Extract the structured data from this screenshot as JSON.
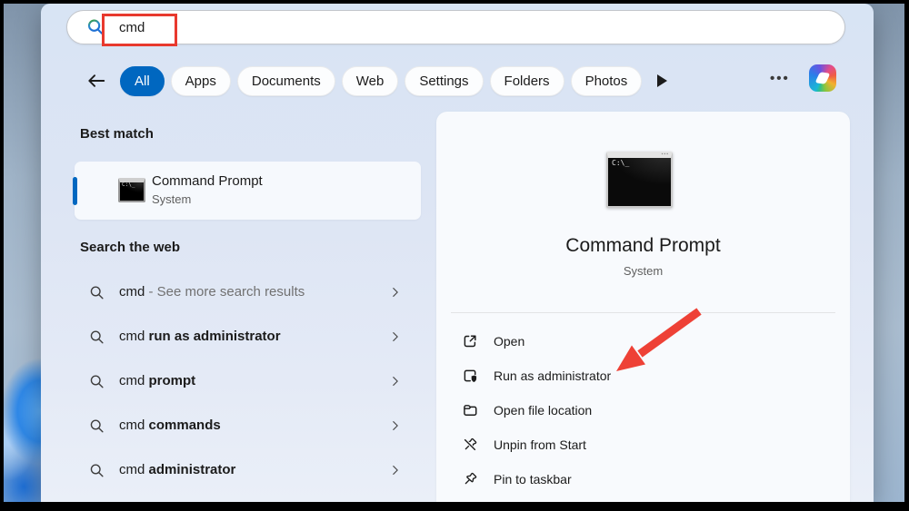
{
  "search": {
    "query": "cmd"
  },
  "tabs": {
    "items": [
      "All",
      "Apps",
      "Documents",
      "Web",
      "Settings",
      "Folders",
      "Photos"
    ],
    "active": "All",
    "more_glyph": "•••"
  },
  "results": {
    "best_match_heading": "Best match",
    "best_match": {
      "title": "Command Prompt",
      "subtitle": "System"
    },
    "web_heading": "Search the web",
    "suggestions": [
      {
        "query": "cmd",
        "suffix": " - See more search results"
      },
      {
        "query": "cmd ",
        "suffix": "run as administrator"
      },
      {
        "query": "cmd ",
        "suffix": "prompt"
      },
      {
        "query": "cmd ",
        "suffix": "commands"
      },
      {
        "query": "cmd ",
        "suffix": "administrator"
      }
    ]
  },
  "details": {
    "title": "Command Prompt",
    "subtitle": "System",
    "actions": [
      {
        "icon": "open-icon",
        "label": "Open"
      },
      {
        "icon": "run-as-administrator-icon",
        "label": "Run as administrator"
      },
      {
        "icon": "folder-icon",
        "label": "Open file location"
      },
      {
        "icon": "unpin-icon",
        "label": "Unpin from Start"
      },
      {
        "icon": "pin-icon",
        "label": "Pin to taskbar"
      }
    ]
  },
  "terminal_glyph": "C:\\_",
  "colors": {
    "accent": "#0067c0",
    "annotation_red": "#ee4136"
  }
}
